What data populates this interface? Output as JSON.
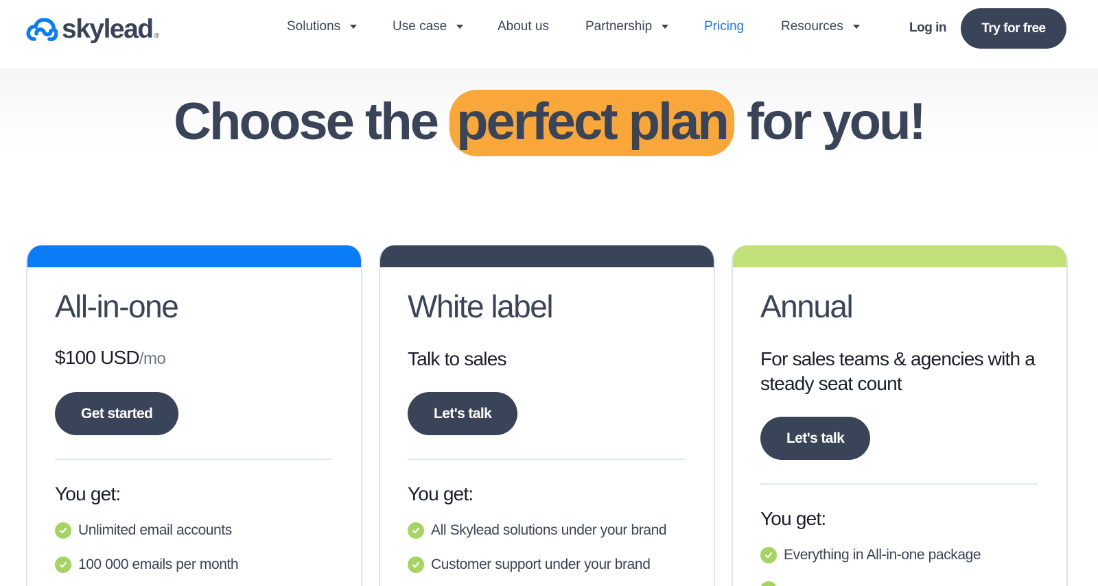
{
  "brand": {
    "name": "skylead",
    "reg": "®"
  },
  "nav": [
    {
      "label": "Solutions",
      "dropdown": true
    },
    {
      "label": "Use case",
      "dropdown": true
    },
    {
      "label": "About us",
      "dropdown": false
    },
    {
      "label": "Partnership",
      "dropdown": true
    },
    {
      "label": "Pricing",
      "dropdown": false,
      "active": true
    },
    {
      "label": "Resources",
      "dropdown": true
    }
  ],
  "header": {
    "login_label": "Log in",
    "cta_label": "Try for free"
  },
  "hero": {
    "before": "Choose the",
    "highlight": "perfect plan",
    "after": "for you!"
  },
  "colors": {
    "accent_blue": "#0a7cf6",
    "dark": "#3a4459",
    "highlight": "#f9a63a",
    "green": "#c2e07a",
    "check": "#a6d462"
  },
  "plans": [
    {
      "title": "All-in-one",
      "price": "$100 USD",
      "price_suffix": "/mo",
      "button": "Get started",
      "you_get": "You get:",
      "features": [
        "Unlimited email accounts",
        "100 000 emails per month"
      ]
    },
    {
      "title": "White label",
      "description": "Talk to sales",
      "button": "Let's talk",
      "you_get": "You get:",
      "features": [
        "All Skylead solutions under your brand",
        "Customer support under your brand"
      ]
    },
    {
      "title": "Annual",
      "description": "For sales teams & agencies with a steady seat count",
      "button": "Let's talk",
      "you_get": "You get:",
      "features": [
        "Everything in All-in-one package"
      ]
    }
  ]
}
